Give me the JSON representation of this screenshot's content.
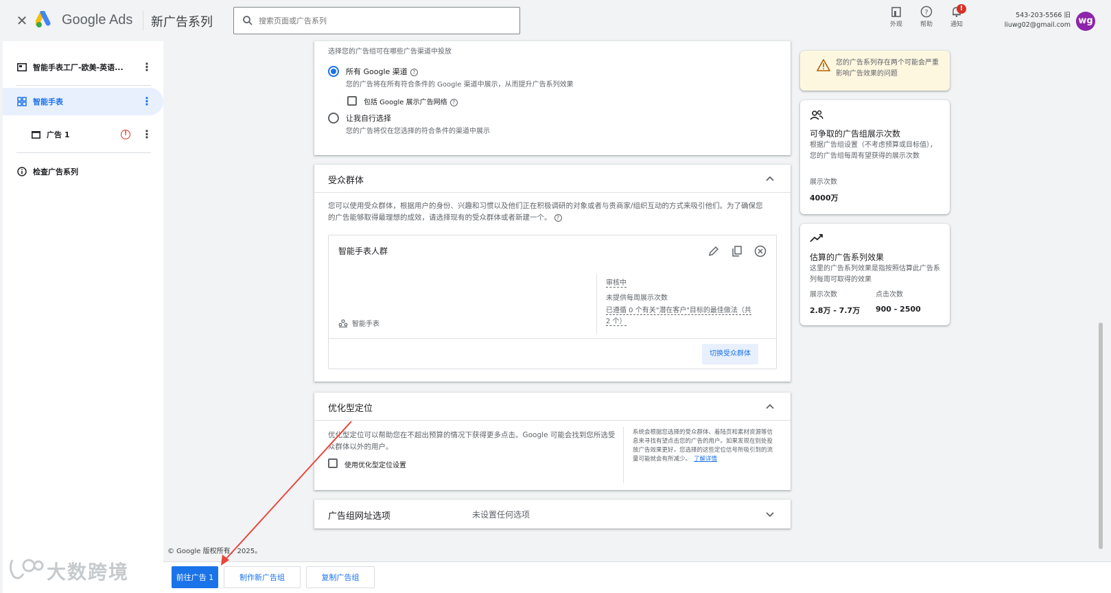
{
  "header": {
    "brand": "Google Ads",
    "campaign_title": "新广告系列",
    "search_placeholder": "搜索页面或广告系列",
    "actions": [
      {
        "label": "外观",
        "icon": "appearance-icon"
      },
      {
        "label": "帮助",
        "icon": "help-icon"
      },
      {
        "label": "通知",
        "icon": "bell-icon",
        "badge": "!"
      }
    ],
    "account_id": "543-203-5566 旧",
    "account_email": "liuwg02@gmail.com",
    "avatar_initials": "wg"
  },
  "sidebar": {
    "items": [
      {
        "label": "智能手表工厂-欧美-英语...",
        "icon": "campaign-icon"
      },
      {
        "label": "智能手表",
        "icon": "ad-group-icon",
        "active": true
      },
      {
        "label": "广告 1",
        "icon": "ad-icon",
        "error": "!"
      },
      {
        "label": "检查广告系列",
        "icon": "info-icon"
      }
    ]
  },
  "network_section": {
    "intro": "选择您的广告组可在哪些广告渠道中投放",
    "option_all_label": "所有 Google 渠道",
    "option_all_desc": "您的广告将在所有符合条件的 Google 渠道中展示，从而提升广告系列效果",
    "include_display_label": "包括 Google 展示广告网络",
    "option_custom_label": "让我自行选择",
    "option_custom_desc": "您的广告将仅在您选择的符合条件的渠道中展示"
  },
  "audience_section": {
    "title": "受众群体",
    "desc": "您可以使用受众群体，根据用户的身份、兴趣和习惯以及他们正在积极调研的对象或者与贵商家/组织互动的方式来吸引他们。为了确保您的广告能够取得最理想的成效，请选择现有的受众群体或者新建一个。",
    "audience_name": "智能手表人群",
    "segment_label": "智能手表",
    "status": "审核中",
    "impressions_note": "未提供每周展示次数",
    "best_practice_note": "已遵循 0 个有关\"潜在客户\"目标的最佳做法（共 2 个）",
    "switch_button": "切换受众群体"
  },
  "optimized_section": {
    "title": "优化型定位",
    "desc": "优化型定位可以帮助您在不超出预算的情况下获得更多点击。Google 可能会找到您所选受众群体以外的用户。",
    "checkbox_label": "使用优化型定位设置",
    "side_note": "系统会根据您选择的受众群体、着陆页和素材资源等信息来寻找有望点击您的广告的用户。如果发现在别处投放广告效果更好，您选择的这些定位信号所吸引到的流量可能就会有所减少。",
    "learn_more": "了解详情"
  },
  "url_section": {
    "title": "广告组网址选项",
    "value": "未设置任何选项"
  },
  "right_panel": {
    "warning": "您的广告系列存在两个可能会严重影响广告效果的问题",
    "reach_title": "可争取的广告组展示次数",
    "reach_desc": "根据广告组设置（不考虑预算或目标值），您的广告组每周有望获得的展示次数",
    "reach_metric_label": "展示次数",
    "reach_metric_value": "4000万",
    "estimate_title": "估算的广告系列效果",
    "estimate_desc": "这里的广告系列效果是指按照估算此广告系列每周可取得的效果",
    "est_impr_label": "展示次数",
    "est_impr_value": "2.8万 - 7.7万",
    "est_click_label": "点击次数",
    "est_click_value": "900 - 2500"
  },
  "footer": {
    "copyright": "© Google 版权所有，2025。",
    "btn_next": "前往广告 1",
    "btn_new_group": "制作新广告组",
    "btn_copy_group": "复制广告组"
  },
  "watermark": {
    "text": "大数跨境"
  },
  "colors": {
    "accent": "#1a73e8",
    "error": "#d93025",
    "warning_bg": "#fef7e0",
    "avatar": "#8e24aa",
    "annotation_arrow": "#e8453c"
  }
}
